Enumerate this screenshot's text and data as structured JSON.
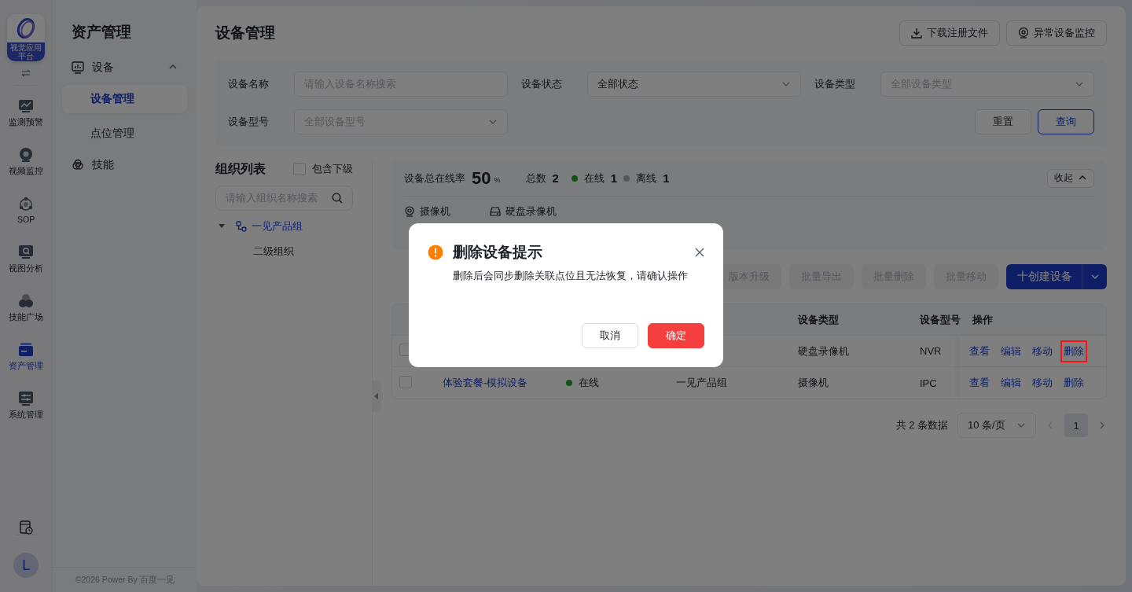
{
  "rail": {
    "logo_caption": "视觉应用平台",
    "items": [
      {
        "label": "监测预警",
        "selected": false
      },
      {
        "label": "视频监控",
        "selected": false
      },
      {
        "label": "SOP",
        "selected": false
      },
      {
        "label": "视图分析",
        "selected": false
      },
      {
        "label": "技能广场",
        "selected": false
      },
      {
        "label": "资产管理",
        "selected": true
      },
      {
        "label": "系统管理",
        "selected": false
      }
    ],
    "avatar": "L"
  },
  "sidebar": {
    "title": "资产管理",
    "items": [
      {
        "label": "设备",
        "expanded": true,
        "children": [
          {
            "label": "设备管理",
            "selected": true
          },
          {
            "label": "点位管理",
            "selected": false
          }
        ]
      },
      {
        "label": "技能"
      }
    ],
    "footer": "©2026 Power By 百度一见"
  },
  "page": {
    "title": "设备管理",
    "actions": [
      "下载注册文件",
      "异常设备监控"
    ]
  },
  "filters": [
    {
      "label": "设备名称",
      "kind": "input",
      "placeholder": "请输入设备名称搜索"
    },
    {
      "label": "设备状态",
      "kind": "select",
      "value": "全部状态"
    },
    {
      "label": "设备类型",
      "kind": "select",
      "placeholder": "全部设备类型"
    },
    {
      "label": "设备型号",
      "kind": "select",
      "placeholder": "全部设备型号"
    }
  ],
  "filter_buttons": [
    "重置",
    "查询"
  ],
  "org": {
    "title": "组织列表",
    "include_sub": {
      "label": "包含下级",
      "checked": false
    },
    "search_placeholder": "请输入组织名称搜索",
    "tree": [
      {
        "label": "一见产品组",
        "selected": true,
        "expanded": true,
        "children": [
          {
            "label": "二级组织",
            "selected": false
          }
        ]
      }
    ]
  },
  "stats": {
    "rate_label": "设备总在线率",
    "rate": "50",
    "rate_unit": "%",
    "total_label": "总数",
    "total": "2",
    "online_label": "在线",
    "online": "1",
    "offline_label": "离线",
    "offline": "1",
    "collapse": "收起",
    "types": [
      "摄像机",
      "硬盘录像机"
    ]
  },
  "toolbar": [
    {
      "label": "版本升级",
      "disabled": true
    },
    {
      "label": "批量导出",
      "disabled": true
    },
    {
      "label": "批量删除",
      "disabled": true
    },
    {
      "label": "批量移动",
      "disabled": true
    }
  ],
  "create_button": "十创建设备",
  "table": {
    "columns": [
      "设备类型",
      "设备型号",
      "操作"
    ],
    "rows": [
      {
        "checked": false,
        "type": "硬盘录像机",
        "model": "NVR",
        "actions": [
          {
            "label": "查看",
            "highlighted": false
          },
          {
            "label": "编辑",
            "highlighted": false
          },
          {
            "label": "移动",
            "highlighted": false
          },
          {
            "label": "删除",
            "highlighted": true
          }
        ]
      },
      {
        "checked": false,
        "name": "体验套餐-模拟设备",
        "status": "在线",
        "online": true,
        "group": "一见产品组",
        "type": "摄像机",
        "model": "IPC",
        "actions": [
          {
            "label": "查看",
            "highlighted": false
          },
          {
            "label": "编辑",
            "highlighted": false
          },
          {
            "label": "移动",
            "highlighted": false
          },
          {
            "label": "删除",
            "highlighted": false
          }
        ]
      }
    ]
  },
  "pagination": {
    "total": "共 2 条数据",
    "page_size": "10 条/页",
    "pages": [
      {
        "label": "1",
        "selected": true
      }
    ]
  },
  "dialog": {
    "title": "删除设备提示",
    "message": "删除后会同步删除关联点位且无法恢复，请确认操作",
    "buttons": [
      {
        "label": "取消",
        "kind": "secondary"
      },
      {
        "label": "确定",
        "kind": "danger"
      }
    ]
  }
}
